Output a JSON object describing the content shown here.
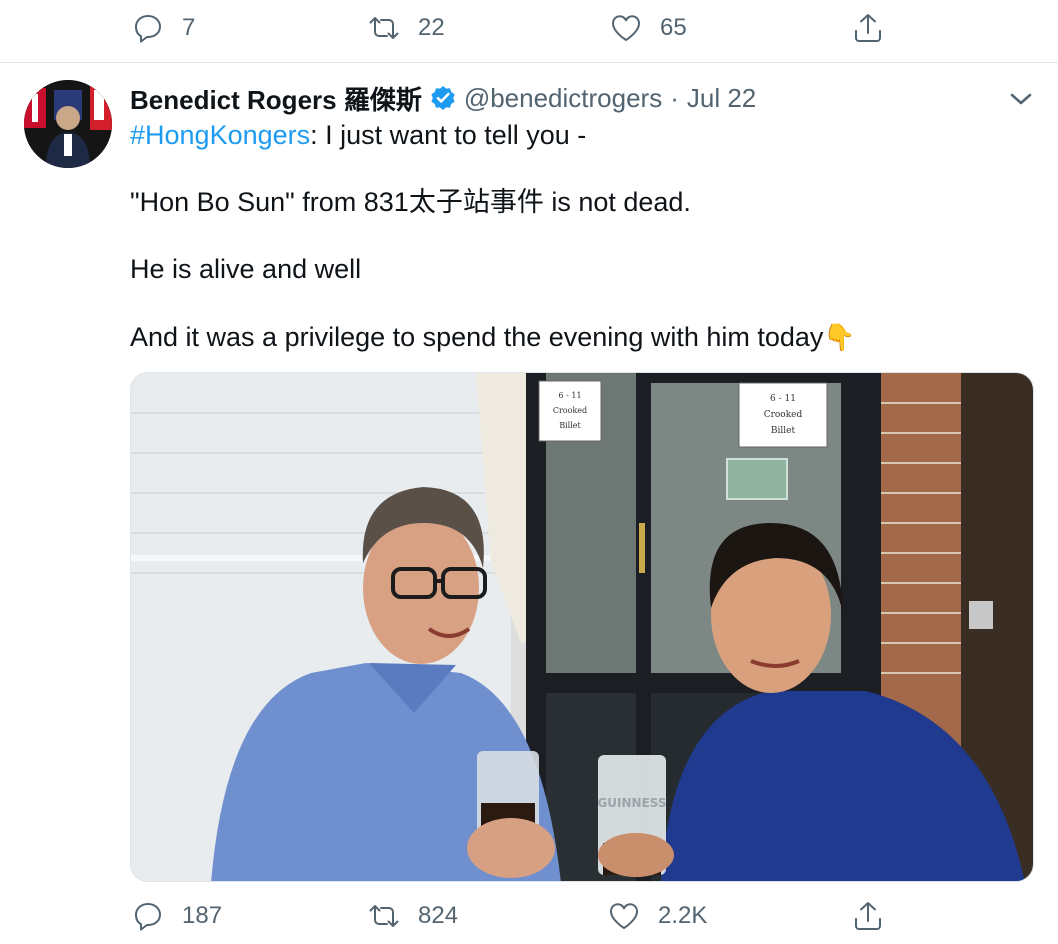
{
  "previous_tweet": {
    "replies": "7",
    "retweets": "22",
    "likes": "65"
  },
  "tweet": {
    "author_name": "Benedict Rogers 羅傑斯",
    "handle": "@benedictrogers",
    "separator": "·",
    "date": "Jul 22",
    "hashtag": "#HongKongers",
    "line1_rest": ": I just want to tell you -",
    "line2": "\"Hon Bo Sun\" from 831太子站事件 is not dead.",
    "line3": "He is alive and well",
    "line4": "And it was a privilege to spend the evening with him today",
    "line4_emoji": "👇",
    "replies": "187",
    "retweets": "824",
    "likes": "2.2K"
  },
  "photo": {
    "sign_left": [
      "6 - 11",
      "Crooked",
      "Billet"
    ],
    "sign_right": [
      "6 - 11",
      "Crooked",
      "Billet"
    ],
    "glass_text": "GUINNESS"
  },
  "icons": {
    "reply": "reply-icon",
    "retweet": "retweet-icon",
    "like": "heart-icon",
    "share": "share-icon",
    "verified": "verified-badge-icon",
    "menu": "chevron-down-icon"
  },
  "colors": {
    "accent": "#1d9bf0",
    "muted": "#536471"
  }
}
